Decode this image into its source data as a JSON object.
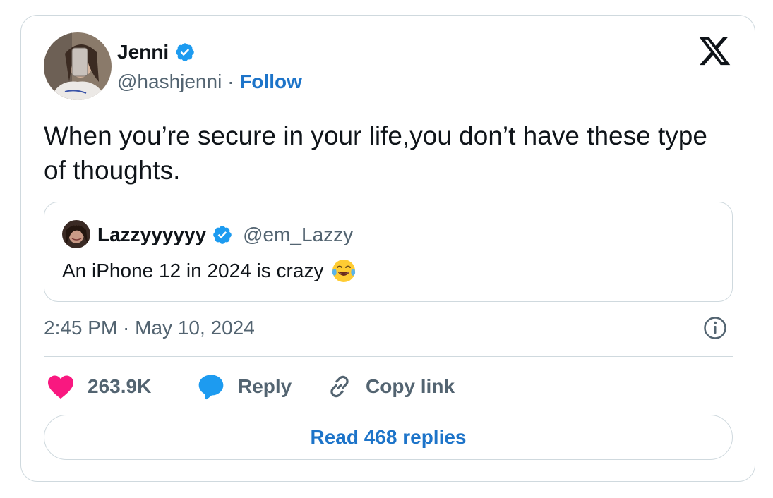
{
  "author": {
    "display_name": "Jenni",
    "handle": "@hashjenni",
    "separator": " · ",
    "follow_label": "Follow",
    "verified_icon": "verified-badge-icon"
  },
  "tweet": {
    "text": "When you’re secure in your life,you don’t have these type of thoughts."
  },
  "quoted_tweet": {
    "display_name": "Lazzyyyyyy",
    "handle": "@em_Lazzy",
    "text": "An iPhone 12 in 2024 is crazy",
    "emoji": "😂"
  },
  "meta": {
    "timestamp": "2:45 PM · May 10, 2024",
    "info_icon": "info-icon",
    "brand_icon": "x-logo-icon"
  },
  "actions": {
    "like_count": "263.9K",
    "reply_label": "Reply",
    "copy_link_label": "Copy link",
    "read_replies_label": "Read 468 replies"
  },
  "colors": {
    "accent_blue": "#1d74c9",
    "verified_blue": "#1d9bf0",
    "like_pink": "#f91880",
    "text_primary": "#0f1419",
    "text_secondary": "#536471",
    "border": "#cfd9de"
  }
}
